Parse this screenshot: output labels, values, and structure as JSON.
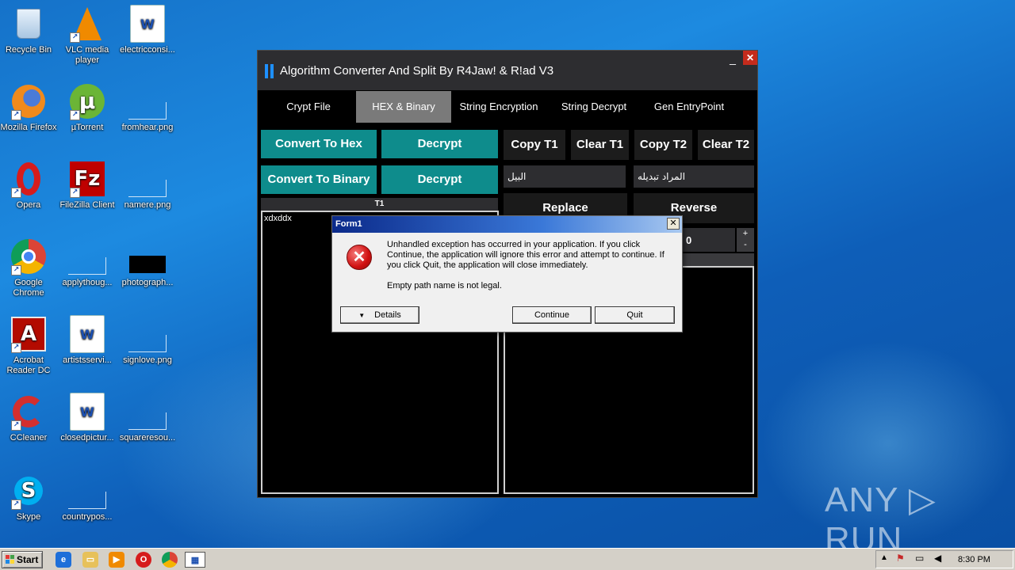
{
  "desktop": {
    "icons": [
      {
        "label": "Recycle Bin"
      },
      {
        "label": "VLC media player"
      },
      {
        "label": "electricconsi..."
      },
      {
        "label": "Mozilla Firefox"
      },
      {
        "label": "µTorrent"
      },
      {
        "label": "fromhear.png"
      },
      {
        "label": "Opera"
      },
      {
        "label": "FileZilla Client"
      },
      {
        "label": "namere.png"
      },
      {
        "label": "Google Chrome"
      },
      {
        "label": "applythoug..."
      },
      {
        "label": "photograph..."
      },
      {
        "label": "Acrobat Reader DC"
      },
      {
        "label": "artistsservi..."
      },
      {
        "label": "signlove.png"
      },
      {
        "label": "CCleaner"
      },
      {
        "label": "closedpictur..."
      },
      {
        "label": "squareresou..."
      },
      {
        "label": "Skype"
      },
      {
        "label": "countrypos..."
      }
    ]
  },
  "app": {
    "title": "Algorithm Converter And Split By R4Jaw! & R!ad V3",
    "minimize": "_",
    "close": "✕",
    "tabs": [
      {
        "label": "Crypt File"
      },
      {
        "label": "HEX & Binary"
      },
      {
        "label": "String Encryption"
      },
      {
        "label": "String Decrypt"
      },
      {
        "label": "Gen EntryPoint"
      }
    ],
    "buttons": {
      "convert_hex": "Convert To Hex",
      "decrypt1": "Decrypt",
      "convert_binary": "Convert To Binary",
      "decrypt2": "Decrypt",
      "copy_t1": "Copy T1",
      "clear_t1": "Clear T1",
      "copy_t2": "Copy T2",
      "clear_t2": "Clear T2",
      "replace": "Replace",
      "reverse": "Reverse"
    },
    "replace_from": "البيل",
    "replace_to": "المراد تبديله",
    "t1_label": "T1",
    "t1_text": "xdxddx",
    "counter_value": "0",
    "plus": "+",
    "minus": "-"
  },
  "dialog": {
    "title": "Form1",
    "close": "✕",
    "message": "Unhandled exception has occurred in your application. If you click Continue, the application will ignore this error and attempt to continue. If you click Quit, the application will close immediately.",
    "detail": "Empty path name is not legal.",
    "details_btn": "Details",
    "continue_btn": "Continue",
    "quit_btn": "Quit"
  },
  "taskbar": {
    "start": "Start",
    "clock": "8:30 PM"
  },
  "watermark": "ANY ▷ RUN",
  "colors": {
    "teal": "#0e8c8c",
    "app_bg": "#000000",
    "title_bg": "#2d2d30",
    "tab_active": "#7a7a7a"
  }
}
